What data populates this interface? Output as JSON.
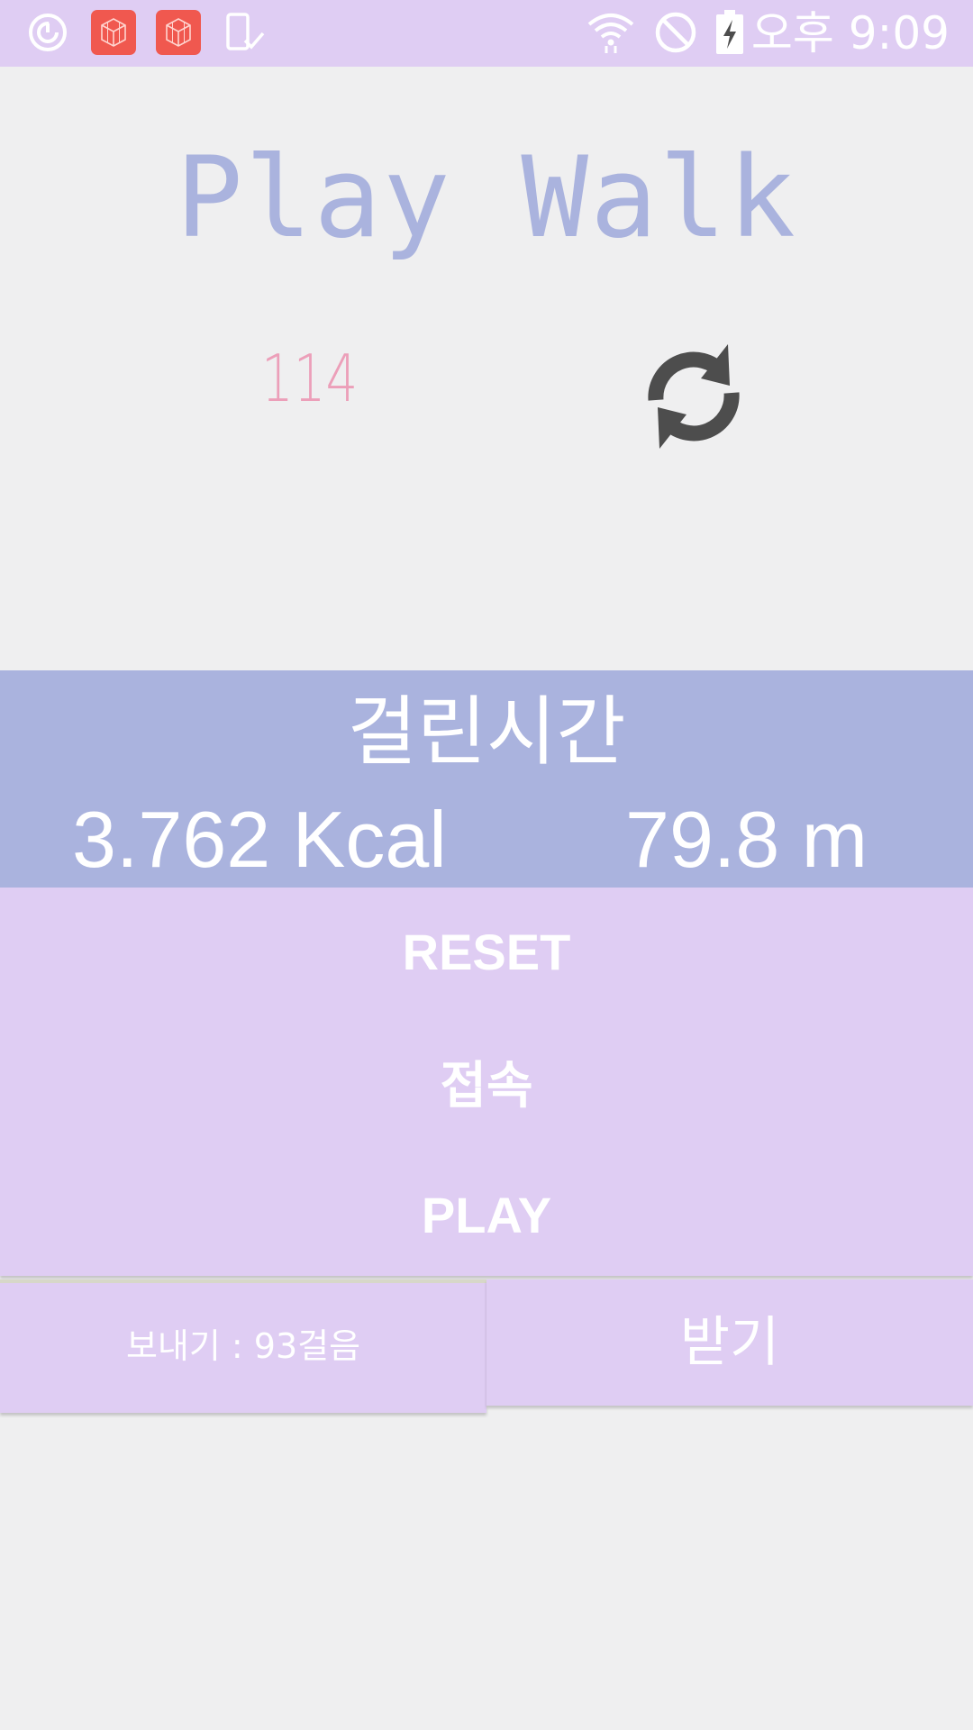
{
  "status_bar": {
    "time": "오후 9:09",
    "left_icons": [
      "sync-circle-icon",
      "app-cube-icon",
      "app-cube-icon",
      "phone-check-icon"
    ],
    "right_icons": [
      "wifi-icon",
      "do-not-disturb-icon",
      "battery-charging-icon"
    ]
  },
  "app": {
    "title": "Play Walk"
  },
  "steps": {
    "count": "114",
    "refresh_icon": "refresh-icon"
  },
  "stats": {
    "label": "걸린시간",
    "kcal": "3.762 Kcal",
    "distance": "79.8 m"
  },
  "buttons": {
    "reset": "RESET",
    "connect": "접속",
    "play": "PLAY",
    "send": "보내기 : 93걸음",
    "receive": "받기"
  },
  "colors": {
    "lavender": "#dfcdf3",
    "periwinkle": "#aab3de",
    "pink": "#ec9fb9",
    "background": "#efeff0",
    "icon_dark": "#4d4d4d",
    "app_icon_red": "#f0584f"
  }
}
